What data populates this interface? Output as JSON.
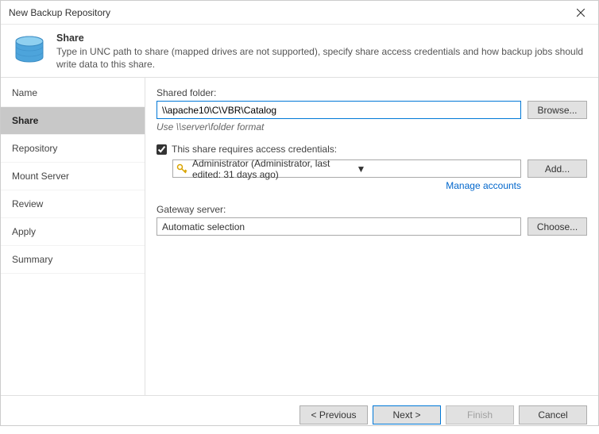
{
  "window": {
    "title": "New Backup Repository"
  },
  "header": {
    "title": "Share",
    "description": "Type in UNC path to share (mapped drives are not supported), specify share access credentials and how backup jobs should write data to this share."
  },
  "sidebar": {
    "items": [
      {
        "label": "Name",
        "selected": false
      },
      {
        "label": "Share",
        "selected": true
      },
      {
        "label": "Repository",
        "selected": false
      },
      {
        "label": "Mount Server",
        "selected": false
      },
      {
        "label": "Review",
        "selected": false
      },
      {
        "label": "Apply",
        "selected": false
      },
      {
        "label": "Summary",
        "selected": false
      }
    ]
  },
  "form": {
    "shared_folder_label": "Shared folder:",
    "shared_folder_value": "\\\\apache10\\C\\VBR\\Catalog",
    "shared_folder_helper": "Use \\\\server\\folder format",
    "browse_button": "Browse...",
    "credentials_checkbox_label": "This share requires access credentials:",
    "credentials_checked": true,
    "credentials_selected": "Administrator (Administrator, last edited: 31 days ago)",
    "add_button": "Add...",
    "manage_accounts_link": "Manage accounts",
    "gateway_label": "Gateway server:",
    "gateway_value": "Automatic selection",
    "choose_button": "Choose..."
  },
  "footer": {
    "previous": "< Previous",
    "next": "Next >",
    "finish": "Finish",
    "cancel": "Cancel",
    "finish_enabled": false
  },
  "colors": {
    "accent": "#0078d7",
    "sidebar_selected": "#c8c8c8",
    "link": "#0066cc"
  }
}
